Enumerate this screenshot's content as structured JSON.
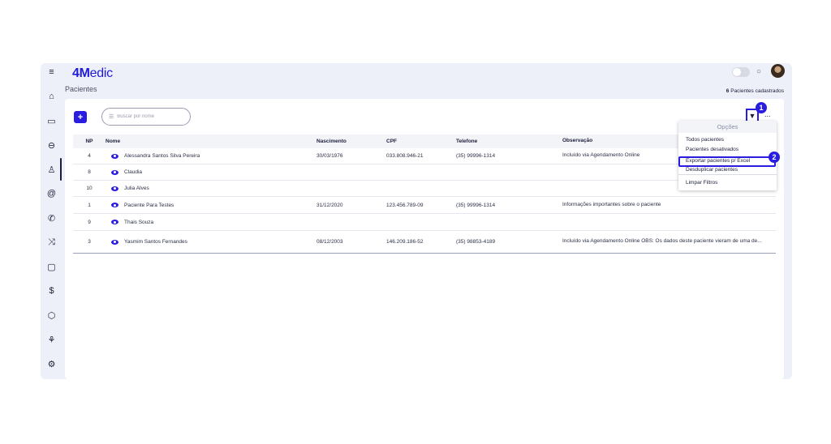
{
  "app": {
    "logo_num": "4",
    "logo_m": "M",
    "logo_rest": "edic",
    "page_title": "Pacientes",
    "count_number": "6",
    "count_label": "Pacientes cadastrados"
  },
  "toolbar": {
    "add_label": "+",
    "search_placeholder": "Buscar por nome",
    "filter_icon": "filter-icon",
    "more_label": "..."
  },
  "badges": {
    "first": "1",
    "second": "2"
  },
  "table": {
    "headers": [
      "NP",
      "Nome",
      "Nascimento",
      "CPF",
      "Telefone",
      "Observação"
    ],
    "rows": [
      {
        "np": "4",
        "nome": "Alessandra Santos Silva Pereira",
        "nasc": "30/03/1976",
        "cpf": "033.808.946-21",
        "tel": "(35) 99996-1314",
        "obs": "Incluído via Agendamento Online"
      },
      {
        "np": "8",
        "nome": "Claudia",
        "nasc": "",
        "cpf": "",
        "tel": "",
        "obs": ""
      },
      {
        "np": "10",
        "nome": "Julia Alves",
        "nasc": "",
        "cpf": "",
        "tel": "",
        "obs": ""
      },
      {
        "np": "1",
        "nome": "Paciente Para Testes",
        "nasc": "31/12/2020",
        "cpf": "123.456.789-09",
        "tel": "(35) 99996-1314",
        "obs": "Informações importantes sobre o paciente"
      },
      {
        "np": "9",
        "nome": "Thais Souza",
        "nasc": "",
        "cpf": "",
        "tel": "",
        "obs": ""
      },
      {
        "np": "3",
        "nome": "Yasmim Santos Fernandes",
        "nasc": "08/12/2003",
        "cpf": "146.209.186-52",
        "tel": "(35) 98853-4189",
        "obs": "Incluído via Agendamento Online OBS: Os dados deste paciente vieram de uma de..."
      }
    ]
  },
  "menu": {
    "title": "Opções",
    "items": [
      "Todos pacientes",
      "Pacientes desativados",
      "Exportar pacientes p/ Excel",
      "Desduplicar pacientes",
      "Limpar Filtros"
    ]
  },
  "sidebar_icons": [
    "menu-icon",
    "home-icon",
    "calendar-icon",
    "sofa-icon",
    "user-icon",
    "at-icon",
    "phone-icon",
    "shuffle-icon",
    "clipboard-icon",
    "dollar-icon",
    "box-icon",
    "chart-icon",
    "settings-icon"
  ],
  "sidebar_glyphs": [
    "≡",
    "⌂",
    "▭",
    "⊖",
    "♙",
    "@",
    "✆",
    "⤨",
    "▢",
    "$",
    "⬡",
    "⚘",
    "⚙"
  ],
  "colors": {
    "accent": "#2a1de0",
    "background": "#eef0f9"
  }
}
